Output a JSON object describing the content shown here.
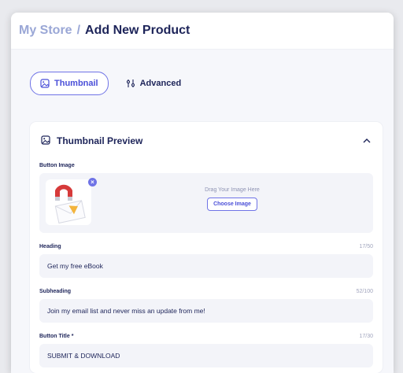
{
  "breadcrumb": {
    "store": "My Store",
    "separator": "/",
    "title": "Add New Product"
  },
  "tabs": [
    {
      "label": "Thumbnail",
      "icon": "image-icon",
      "active": true
    },
    {
      "label": "Advanced",
      "icon": "sliders-icon",
      "active": false
    }
  ],
  "card": {
    "title": "Thumbnail Preview",
    "collapse_icon": "chevron-up-icon",
    "button_image": {
      "label": "Button Image",
      "drag_text": "Drag Your Image Here",
      "choose_label": "Choose Image",
      "remove_label": "×"
    },
    "fields": [
      {
        "label": "Heading",
        "counter": "17/50",
        "value": "Get my free eBook"
      },
      {
        "label": "Subheading",
        "counter": "52/100",
        "value": "Join my email list and never miss an update from me!"
      },
      {
        "label": "Button Title *",
        "counter": "17/30",
        "value": "SUBMIT & DOWNLOAD"
      }
    ]
  },
  "colors": {
    "accent": "#6f73e6",
    "text_dark": "#1d2459",
    "breadcrumb_muted": "#9aa7d6",
    "field_bg": "#f3f4f9"
  }
}
